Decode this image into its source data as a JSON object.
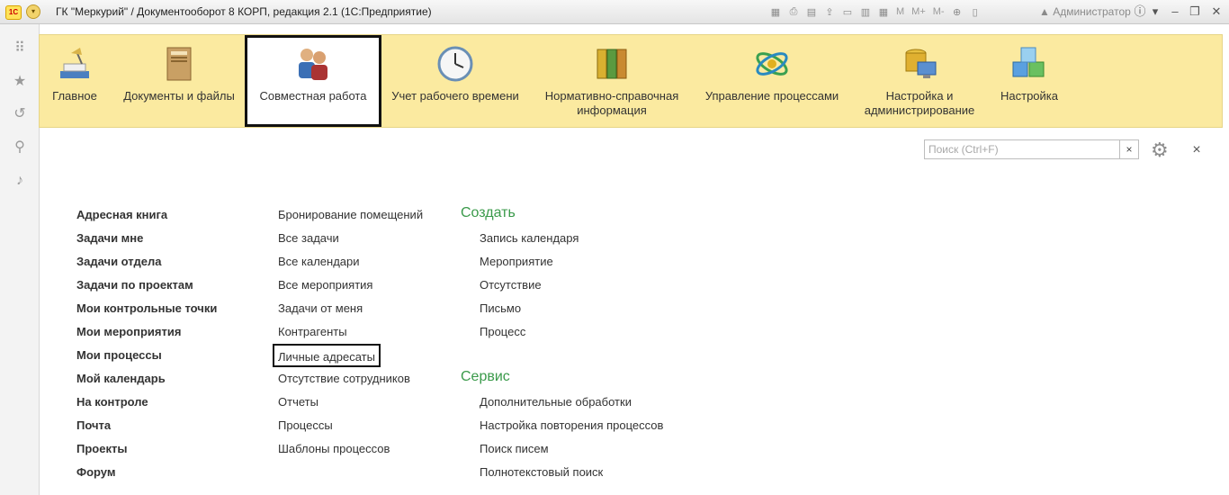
{
  "window": {
    "title": "ГК \"Меркурий\" / Документооборот 8 КОРП, редакция 2.1  (1С:Предприятие)",
    "user": "Администратор",
    "toolbar_text": [
      "M",
      "M+",
      "M-"
    ]
  },
  "sections": [
    {
      "label": "Главное"
    },
    {
      "label": "Документы и файлы"
    },
    {
      "label": "Совместная работа"
    },
    {
      "label": "Учет рабочего времени"
    },
    {
      "label": "Нормативно-справочная\nинформация"
    },
    {
      "label": "Управление процессами"
    },
    {
      "label": "Настройка и\nадминистрирование"
    },
    {
      "label": "Настройка"
    }
  ],
  "search": {
    "placeholder": "Поиск (Ctrl+F)",
    "value": ""
  },
  "column1": [
    "Адресная книга",
    "Задачи мне",
    "Задачи отдела",
    "Задачи по проектам",
    "Мои контрольные точки",
    "Мои мероприятия",
    "Мои процессы",
    "Мой календарь",
    "На контроле",
    "Почта",
    "Проекты",
    "Форум"
  ],
  "column2": [
    "Бронирование помещений",
    "Все задачи",
    "Все календари",
    "Все мероприятия",
    "Задачи от меня",
    "Контрагенты",
    "Личные адресаты",
    "Отсутствие сотрудников",
    "Отчеты",
    "Процессы",
    "Шаблоны процессов"
  ],
  "create": {
    "title": "Создать",
    "items": [
      "Запись календаря",
      "Мероприятие",
      "Отсутствие",
      "Письмо",
      "Процесс"
    ]
  },
  "service": {
    "title": "Сервис",
    "items": [
      "Дополнительные обработки",
      "Настройка повторения процессов",
      "Поиск писем",
      "Полнотекстовый поиск"
    ]
  },
  "colors": {
    "section_bg": "#fbeaa0",
    "header_green": "#3a9a4a"
  }
}
